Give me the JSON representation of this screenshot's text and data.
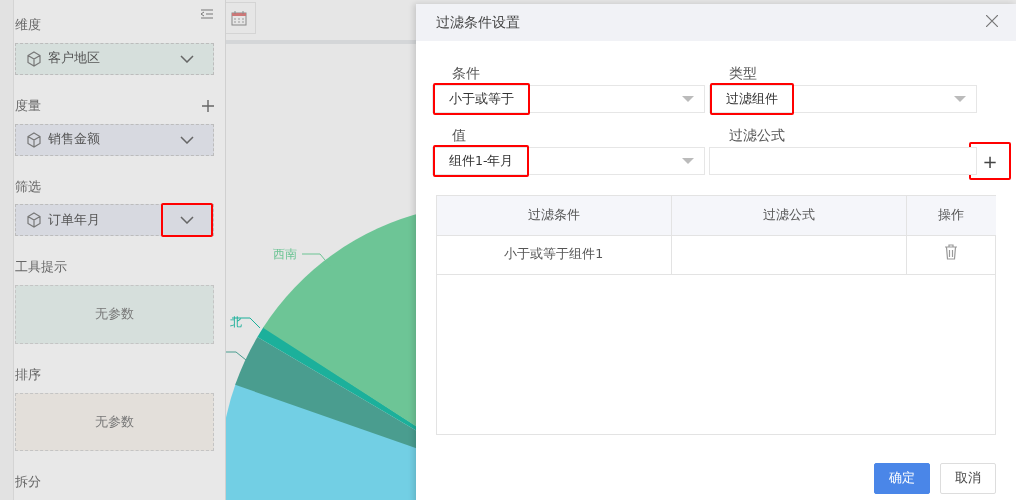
{
  "sidebar": {
    "sections": [
      {
        "title": "维度",
        "kind": "collapsible",
        "items": [
          {
            "kind": "field",
            "label": "客户地区",
            "color": "#d6dfdc",
            "highlighted": false
          }
        ]
      },
      {
        "title": "度量",
        "kind": "addable",
        "items": [
          {
            "kind": "field",
            "label": "销售金额",
            "color": "#d7d9e0",
            "highlighted": false
          }
        ]
      },
      {
        "title": "筛选",
        "kind": "plain",
        "items": [
          {
            "kind": "field",
            "label": "订单年月",
            "color": "#d7d9e0",
            "highlighted": true
          }
        ]
      },
      {
        "title": "工具提示",
        "kind": "plain",
        "items": [
          {
            "kind": "empty",
            "label": "无参数",
            "color": "#d6dfdc"
          }
        ]
      },
      {
        "title": "排序",
        "kind": "plain",
        "items": [
          {
            "kind": "empty",
            "label": "无参数",
            "color": "#e3dfda"
          }
        ]
      },
      {
        "title": "拆分",
        "kind": "plain"
      }
    ]
  },
  "chart": {
    "labels": [
      {
        "text": "西南"
      },
      {
        "text": "北"
      }
    ]
  },
  "dialog": {
    "title": "过滤条件设置",
    "fields": [
      {
        "kind": "select",
        "label": "条件",
        "value": "小于或等于",
        "highlighted": true
      },
      {
        "kind": "select",
        "label": "类型",
        "value": "过滤组件",
        "highlighted": true
      },
      {
        "kind": "select",
        "label": "值",
        "value": "组件1-年月",
        "highlighted": true
      },
      {
        "kind": "input",
        "label": "过滤公式",
        "highlighted": false
      }
    ],
    "add_button": {
      "label": "+",
      "highlighted": true
    },
    "table": {
      "columns": [
        "过滤条件",
        "过滤公式",
        "操作"
      ],
      "rows": [
        [
          "小于或等于组件1",
          ""
        ]
      ]
    },
    "buttons": [
      {
        "label": "确定",
        "kind": "primary"
      },
      {
        "label": "取消",
        "kind": "secondary"
      }
    ]
  }
}
